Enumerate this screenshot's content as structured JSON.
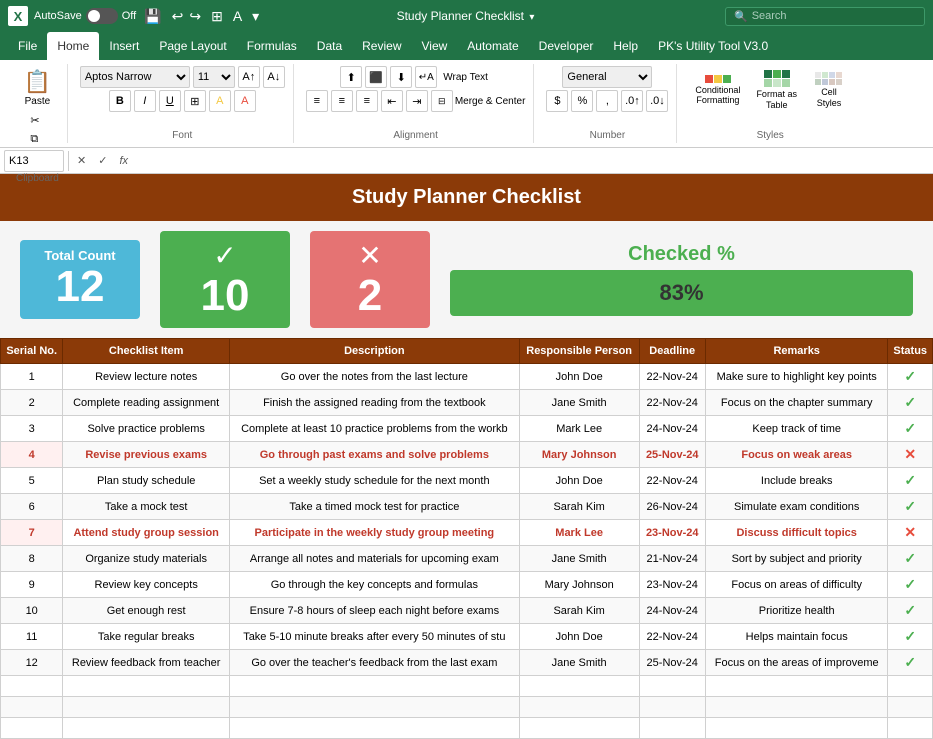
{
  "titlebar": {
    "app": "X",
    "autosave_label": "AutoSave",
    "toggle_state": "Off",
    "filename": "Study Planner Checklist",
    "search_placeholder": "Search"
  },
  "ribbon_tabs": [
    "File",
    "Home",
    "Insert",
    "Page Layout",
    "Formulas",
    "Data",
    "Review",
    "View",
    "Automate",
    "Developer",
    "Help",
    "PK's Utility Tool V3.0"
  ],
  "active_tab": "Home",
  "ribbon": {
    "clipboard": "Clipboard",
    "font_group": "Font",
    "alignment_group": "Alignment",
    "number_group": "Number",
    "styles_group": "Styles",
    "font_name": "Aptos Narrow",
    "font_size": "11",
    "wrap_text": "Wrap Text",
    "merge_center": "Merge & Center",
    "format_general": "General",
    "conditional_formatting": "Conditional Formatting",
    "format_as_table": "Format as Table",
    "cell_styles": "Cell Styles",
    "paste_label": "Paste"
  },
  "formula_bar": {
    "cell_ref": "K13",
    "formula": ""
  },
  "sheet_title": "Study Planner Checklist",
  "summary": {
    "total_label": "Total Count",
    "total_value": "12",
    "checked_value": "10",
    "unchecked_value": "2",
    "percent_label": "Checked %",
    "percent_value": "83%"
  },
  "table": {
    "headers": [
      "Serial No.",
      "Checklist Item",
      "Description",
      "Responsible Person",
      "Deadline",
      "Remarks",
      "Status"
    ],
    "rows": [
      {
        "serial": "1",
        "item": "Review lecture notes",
        "description": "Go over the notes from the last lecture",
        "person": "John Doe",
        "deadline": "22-Nov-24",
        "remarks": "Make sure to highlight key points",
        "status": "check",
        "highlight": false
      },
      {
        "serial": "2",
        "item": "Complete reading assignment",
        "description": "Finish the assigned reading from the textbook",
        "person": "Jane Smith",
        "deadline": "22-Nov-24",
        "remarks": "Focus on the chapter summary",
        "status": "check",
        "highlight": false
      },
      {
        "serial": "3",
        "item": "Solve practice problems",
        "description": "Complete at least 10 practice problems from the workb",
        "person": "Mark Lee",
        "deadline": "24-Nov-24",
        "remarks": "Keep track of time",
        "status": "check",
        "highlight": false
      },
      {
        "serial": "4",
        "item": "Revise previous exams",
        "description": "Go through past exams and solve problems",
        "person": "Mary Johnson",
        "deadline": "25-Nov-24",
        "remarks": "Focus on weak areas",
        "status": "x",
        "highlight": true
      },
      {
        "serial": "5",
        "item": "Plan study schedule",
        "description": "Set a weekly study schedule for the next month",
        "person": "John Doe",
        "deadline": "22-Nov-24",
        "remarks": "Include breaks",
        "status": "check",
        "highlight": false
      },
      {
        "serial": "6",
        "item": "Take a mock test",
        "description": "Take a timed mock test for practice",
        "person": "Sarah Kim",
        "deadline": "26-Nov-24",
        "remarks": "Simulate exam conditions",
        "status": "check",
        "highlight": false
      },
      {
        "serial": "7",
        "item": "Attend study group session",
        "description": "Participate in the weekly study group meeting",
        "person": "Mark Lee",
        "deadline": "23-Nov-24",
        "remarks": "Discuss difficult topics",
        "status": "x",
        "highlight": true
      },
      {
        "serial": "8",
        "item": "Organize study materials",
        "description": "Arrange all notes and materials for upcoming exam",
        "person": "Jane Smith",
        "deadline": "21-Nov-24",
        "remarks": "Sort by subject and priority",
        "status": "check",
        "highlight": false
      },
      {
        "serial": "9",
        "item": "Review key concepts",
        "description": "Go through the key concepts and formulas",
        "person": "Mary Johnson",
        "deadline": "23-Nov-24",
        "remarks": "Focus on areas of difficulty",
        "status": "check",
        "highlight": false
      },
      {
        "serial": "10",
        "item": "Get enough rest",
        "description": "Ensure 7-8 hours of sleep each night before exams",
        "person": "Sarah Kim",
        "deadline": "24-Nov-24",
        "remarks": "Prioritize health",
        "status": "check",
        "highlight": false
      },
      {
        "serial": "11",
        "item": "Take regular breaks",
        "description": "Take 5-10 minute breaks after every 50 minutes of stu",
        "person": "John Doe",
        "deadline": "22-Nov-24",
        "remarks": "Helps maintain focus",
        "status": "check",
        "highlight": false
      },
      {
        "serial": "12",
        "item": "Review feedback from teacher",
        "description": "Go over the teacher's feedback from the last exam",
        "person": "Jane Smith",
        "deadline": "25-Nov-24",
        "remarks": "Focus on the areas of improveme",
        "status": "check",
        "highlight": false
      }
    ]
  }
}
